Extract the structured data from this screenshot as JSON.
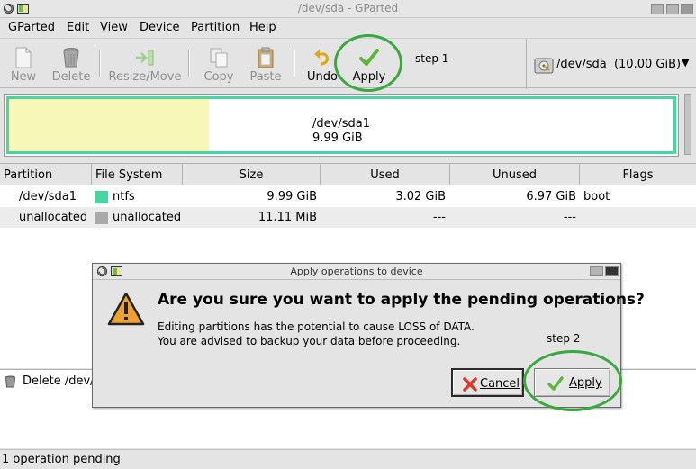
{
  "window": {
    "title": "/dev/sda - GParted"
  },
  "menu": [
    "GParted",
    "Edit",
    "View",
    "Device",
    "Partition",
    "Help"
  ],
  "toolbar": {
    "new": "New",
    "delete": "Delete",
    "resize": "Resize/Move",
    "copy": "Copy",
    "paste": "Paste",
    "undo": "Undo",
    "apply": "Apply",
    "step1": "step 1"
  },
  "device_selector": {
    "label": "/dev/sda  (10.00 GiB)"
  },
  "disk_map": {
    "partition": "/dev/sda1",
    "size": "9.99 GiB",
    "used_fraction": 0.302
  },
  "table": {
    "columns": [
      "Partition",
      "File System",
      "Size",
      "Used",
      "Unused",
      "Flags"
    ],
    "rows": [
      {
        "partition": "/dev/sda1",
        "fs": "ntfs",
        "size": "9.99 GiB",
        "used": "3.02 GiB",
        "unused": "6.97 GiB",
        "flags": "boot"
      },
      {
        "partition": "unallocated",
        "fs": "unallocated",
        "size": "11.11 MiB",
        "used": "---",
        "unused": "---",
        "flags": ""
      }
    ]
  },
  "pending_ops": {
    "item": "Delete /dev/"
  },
  "status": "1 operation pending",
  "dialog": {
    "title": "Apply operations to device",
    "primary": "Are you sure you want to apply the pending operations?",
    "line1": "Editing partitions has the potential to cause LOSS of DATA.",
    "line2": "You are advised to backup your data before proceeding.",
    "cancel": "Cancel",
    "apply": "Apply",
    "step2": "step 2"
  },
  "colors": {
    "ntfs": "#46d7a0",
    "unallocated": "#a9a9a9",
    "used": "#f7f7b8",
    "annotation": "#3aa83e"
  }
}
